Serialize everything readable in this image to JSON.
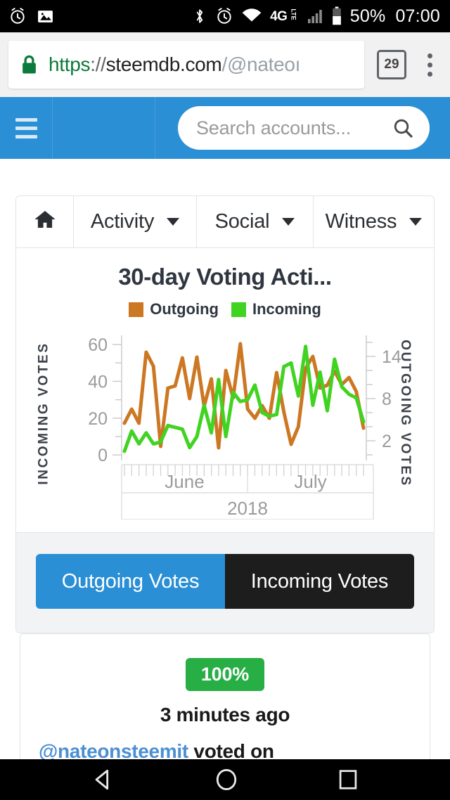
{
  "status_bar": {
    "left_icons": [
      "alarm-clock-icon",
      "photo-icon"
    ],
    "right_icons": [
      "bluetooth-icon",
      "alarm-clock-icon",
      "wifi-icon",
      "signal-bars-icon",
      "battery-icon"
    ],
    "network_big": "4G",
    "network_small": "LTE",
    "battery_percent": "50%",
    "time": "07:00"
  },
  "browser": {
    "lock_icon": "lock-icon",
    "url_scheme": "https",
    "url_separator": "://",
    "url_host": "steemdb.com",
    "url_slash": "/",
    "url_path": "@nateoı",
    "tab_count": "29",
    "menu_icon": "kebab-menu-icon"
  },
  "appbar": {
    "menu_icon": "hamburger-icon",
    "search_placeholder": "Search accounts...",
    "search_value": "",
    "search_icon": "search-icon",
    "background": "#2a8fd4"
  },
  "nav_tabs": [
    {
      "name": "home",
      "label": "",
      "icon": "home-icon",
      "caret": false
    },
    {
      "name": "activity",
      "label": "Activity",
      "icon": "",
      "caret": true
    },
    {
      "name": "social",
      "label": "Social",
      "icon": "",
      "caret": true
    },
    {
      "name": "witness",
      "label": "Witness",
      "icon": "",
      "caret": true
    }
  ],
  "chart_data": {
    "type": "line",
    "title": "30-day Voting Acti...",
    "xlabel": "",
    "ylabel": "INCOMING VOTES",
    "y2label": "OUTGOING VOTES",
    "grid": false,
    "legend_position": "top-center",
    "x_tick_labels": [
      "June",
      "July"
    ],
    "x_super_label": "2018",
    "y_left_ticks": [
      0,
      20,
      40,
      60
    ],
    "y_left_minor_ticks": [
      10,
      30,
      50
    ],
    "ylim": [
      -3,
      65
    ],
    "y_right_ticks": [
      2,
      8,
      14
    ],
    "y2lim": [
      -0.8,
      17
    ],
    "colors": {
      "outgoing": "#cc7722",
      "incoming": "#41d321"
    },
    "series": [
      {
        "name": "Outgoing",
        "axis": "right",
        "color": "#cc7722",
        "values": [
          4.5,
          6.5,
          4.5,
          14.6,
          12.6,
          1.2,
          9.5,
          9.8,
          13.8,
          8.0,
          13.9,
          6.9,
          10.8,
          1.0,
          12.0,
          8.1,
          15.8,
          6.5,
          5.2,
          7.0,
          5.2,
          11.7,
          6.1,
          1.5,
          4.0,
          12.3,
          14.0,
          9.5,
          9.9,
          11.9,
          10.0,
          11.0,
          9.0,
          3.8
        ]
      },
      {
        "name": "Incoming",
        "axis": "left",
        "color": "#41d321",
        "values": [
          2,
          13,
          6,
          12,
          6,
          7,
          16,
          15,
          14,
          4,
          10,
          27,
          12,
          41,
          10,
          34,
          29,
          30,
          38,
          23,
          21,
          22,
          48,
          50,
          32,
          59,
          27,
          45,
          24,
          52,
          37,
          33,
          31,
          18
        ]
      }
    ]
  },
  "toggle_buttons": [
    {
      "label": "Outgoing Votes",
      "active": true
    },
    {
      "label": "Incoming Votes",
      "active": false
    }
  ],
  "vote_card": {
    "percent_badge": "100%",
    "timestamp": "3 minutes ago",
    "actor": "@nateonsteemit",
    "action_text": " voted on"
  },
  "android_nav": {
    "back_icon": "back-triangle-icon",
    "home_icon": "home-circle-icon",
    "recents_icon": "recents-square-icon"
  }
}
